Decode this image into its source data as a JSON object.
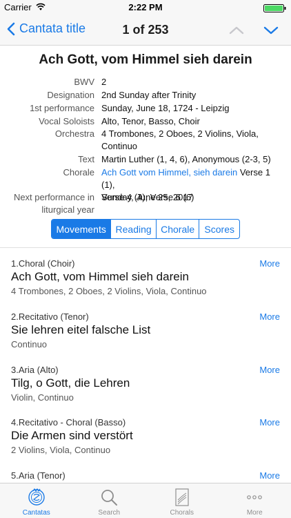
{
  "status": {
    "carrier": "Carrier",
    "time": "2:22 PM"
  },
  "nav": {
    "back_label": "Cantata title",
    "title": "1 of 253"
  },
  "cantata": {
    "title": "Ach Gott, vom Himmel sieh darein",
    "info": {
      "bwv_label": "BWV",
      "bwv": "2",
      "designation_label": "Designation",
      "designation": "2nd Sunday after Trinity",
      "first_performance_label": "1st performance",
      "first_performance": "Sunday, June 18, 1724 - Leipzig",
      "vocal_soloists_label": "Vocal Soloists",
      "vocal_soloists": "Alto, Tenor, Basso, Choir",
      "orchestra_label": "Orchestra",
      "orchestra_line1": "4 Trombones, 2 Oboes, 2 Violins, Viola,",
      "orchestra_line2": "Continuo",
      "text_label": "Text",
      "text": "Martin Luther (1, 4, 6), Anonymous (2-3, 5)",
      "chorale_label": "Chorale",
      "chorale_link": "Ach Gott vom Himmel, sieh darein",
      "chorale_rest1": " Verse 1 (1),",
      "chorale_line2": "Verse 4 (4), Verse 6 (6)",
      "next_performance_label1": "Next performance in",
      "next_performance_label2": "liturgical year",
      "next_performance": "Sunday, June 25, 2017"
    }
  },
  "segments": [
    "Movements",
    "Reading",
    "Chorale",
    "Scores"
  ],
  "more_label": "More",
  "movements": [
    {
      "type": "1.Choral (Choir)",
      "title": "Ach Gott, vom Himmel sieh darein",
      "orchestra": "4 Trombones, 2 Oboes, 2 Violins, Viola, Continuo"
    },
    {
      "type": "2.Recitativo (Tenor)",
      "title": "Sie lehren eitel falsche List",
      "orchestra": "Continuo"
    },
    {
      "type": "3.Aria (Alto)",
      "title": "Tilg, o Gott, die Lehren",
      "orchestra": "Violin, Continuo"
    },
    {
      "type": "4.Recitativo - Choral (Basso)",
      "title": "Die Armen sind verstört",
      "orchestra": "2 Violins, Viola, Continuo"
    },
    {
      "type": "5.Aria (Tenor)",
      "title": "",
      "orchestra": ""
    }
  ],
  "tabs": [
    "Cantatas",
    "Search",
    "Chorals",
    "More"
  ],
  "colors": {
    "accent": "#1a7ae6",
    "bar_bg": "#f7f7f7",
    "battery": "#4cd964"
  }
}
